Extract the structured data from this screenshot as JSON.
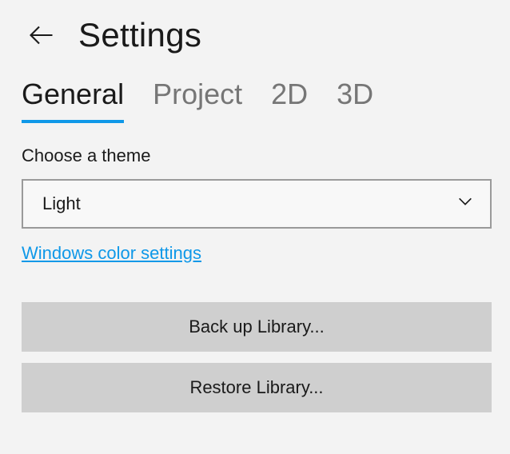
{
  "header": {
    "title": "Settings"
  },
  "tabs": [
    {
      "label": "General",
      "active": true
    },
    {
      "label": "Project",
      "active": false
    },
    {
      "label": "2D",
      "active": false
    },
    {
      "label": "3D",
      "active": false
    }
  ],
  "general": {
    "theme_label": "Choose a theme",
    "theme_value": "Light",
    "color_settings_link": "Windows color settings",
    "backup_button": "Back up Library...",
    "restore_button": "Restore Library..."
  }
}
